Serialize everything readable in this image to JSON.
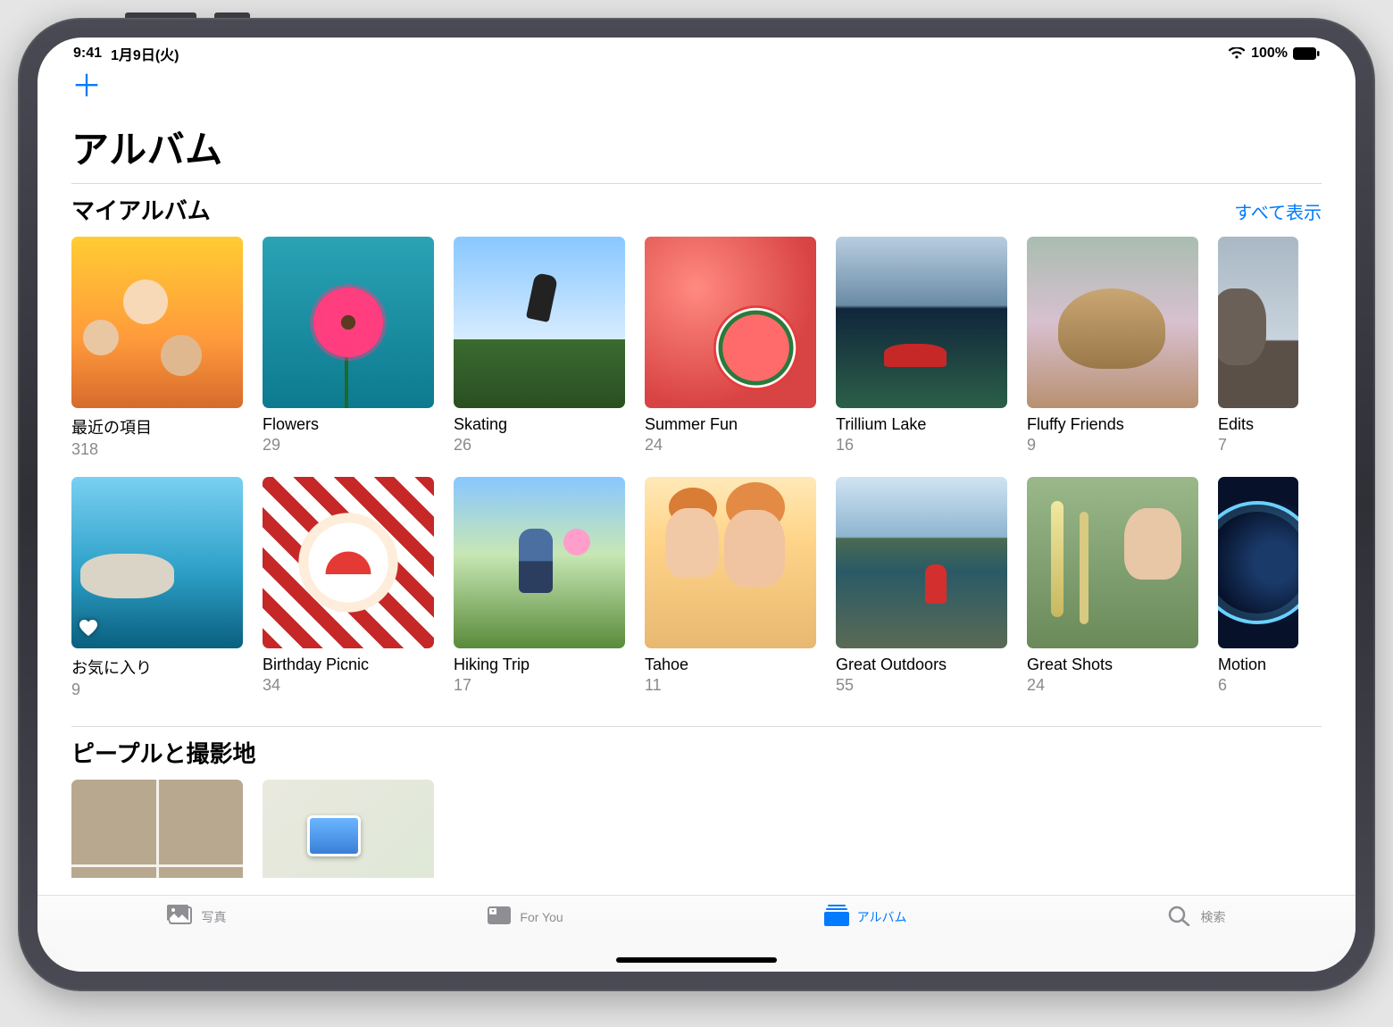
{
  "statusbar": {
    "time": "9:41",
    "date": "1月9日(火)",
    "battery_pct": "100%"
  },
  "nav": {
    "title": "アルバム"
  },
  "sections": {
    "my_albums": {
      "title": "マイアルバム",
      "see_all": "すべて表示",
      "row1": [
        {
          "name": "最近の項目",
          "count": "318",
          "thumb": "t-recents"
        },
        {
          "name": "Flowers",
          "count": "29",
          "thumb": "t-flowers"
        },
        {
          "name": "Skating",
          "count": "26",
          "thumb": "t-skating"
        },
        {
          "name": "Summer Fun",
          "count": "24",
          "thumb": "t-summer"
        },
        {
          "name": "Trillium Lake",
          "count": "16",
          "thumb": "t-trillium"
        },
        {
          "name": "Fluffy Friends",
          "count": "9",
          "thumb": "t-fluffy"
        },
        {
          "name": "Edits",
          "count": "7",
          "thumb": "t-edits",
          "partial": true
        }
      ],
      "row2": [
        {
          "name": "お気に入り",
          "count": "9",
          "thumb": "t-favs",
          "favorite": true
        },
        {
          "name": "Birthday Picnic",
          "count": "34",
          "thumb": "t-bday"
        },
        {
          "name": "Hiking Trip",
          "count": "17",
          "thumb": "t-hiking"
        },
        {
          "name": "Tahoe",
          "count": "11",
          "thumb": "t-tahoe"
        },
        {
          "name": "Great Outdoors",
          "count": "55",
          "thumb": "t-outdoors"
        },
        {
          "name": "Great Shots",
          "count": "24",
          "thumb": "t-shots"
        },
        {
          "name": "Motion",
          "count": "6",
          "thumb": "t-motion",
          "partial": true
        }
      ]
    },
    "people_places": {
      "title": "ピープルと撮影地"
    }
  },
  "tabbar": {
    "photos": "写真",
    "for_you": "For You",
    "albums": "アルバム",
    "search": "検索"
  }
}
